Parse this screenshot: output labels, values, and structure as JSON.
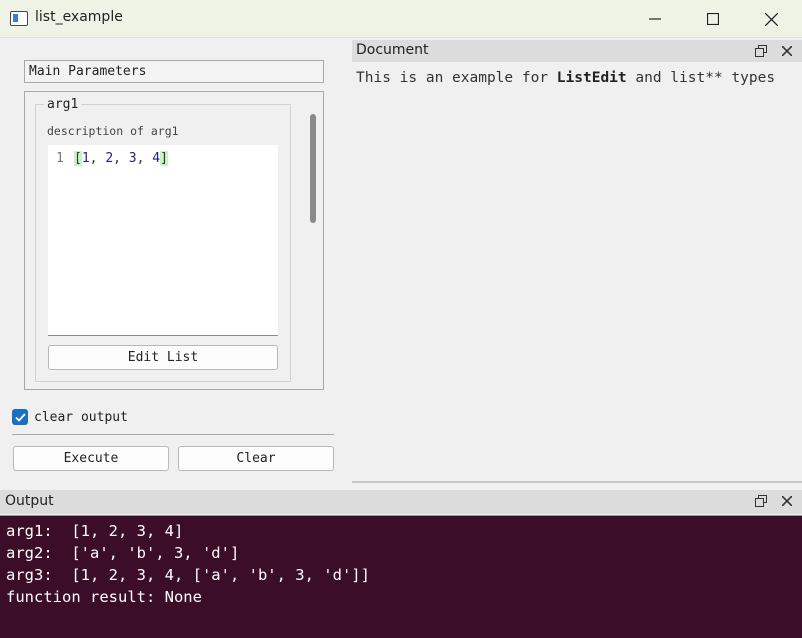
{
  "window": {
    "title": "list_example"
  },
  "params": {
    "header": "Main Parameters",
    "arg1": {
      "title": "arg1",
      "description": "description of arg1",
      "line_number": "1",
      "code": {
        "open": "[",
        "n1": "1",
        "n2": "2",
        "n3": "3",
        "n4": "4",
        "close": "]",
        "sep": ", "
      },
      "edit_button": "Edit List"
    }
  },
  "controls": {
    "clear_output": {
      "label": "clear output",
      "checked": true
    },
    "execute": "Execute",
    "clear": "Clear"
  },
  "document": {
    "title": "Document",
    "text": {
      "part1": "This is an example for ",
      "bold": "ListEdit",
      "part2": " and list** types"
    }
  },
  "output": {
    "title": "Output",
    "lines": [
      "arg1:  [1, 2, 3, 4]",
      "arg2:  ['a', 'b', 3, 'd']",
      "arg3:  [1, 2, 3, 4, ['a', 'b', 3, 'd']]",
      "function result: None"
    ]
  },
  "colors": {
    "output_bg": "#3c0d28",
    "checkbox": "#1a6fc2",
    "bracket_highlight": "#c9f3c4"
  }
}
